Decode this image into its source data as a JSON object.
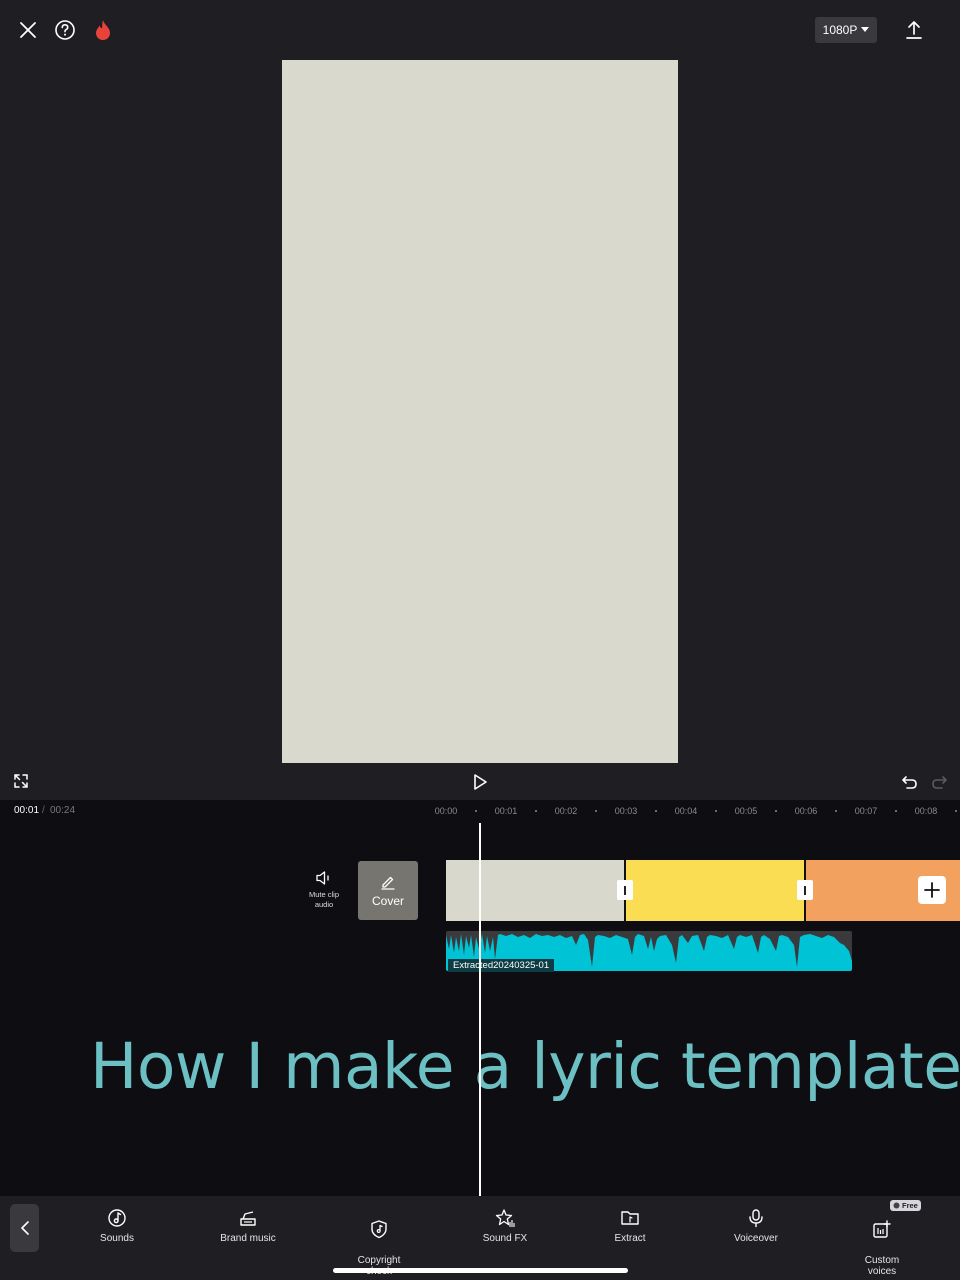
{
  "header": {
    "close_icon": "close-icon",
    "help_icon": "help-icon",
    "fire_icon": "fire-icon",
    "resolution": "1080P",
    "export_icon": "export-icon"
  },
  "player": {
    "fullscreen_icon": "fullscreen-icon",
    "play_icon": "play-icon",
    "undo_icon": "undo-icon",
    "redo_icon": "redo-icon",
    "current_time": "00:01",
    "separator": "/",
    "total_time": "00:24"
  },
  "timeline": {
    "ticks": [
      "00:00",
      "00:01",
      "00:02",
      "00:03",
      "00:04",
      "00:05",
      "00:06",
      "00:07",
      "00:08"
    ],
    "mute_label": "Mute clip audio",
    "cover_label": "Cover",
    "clips": [
      {
        "color": "#d8d8cc"
      },
      {
        "color": "#fbdd54"
      },
      {
        "color": "#f3a15f"
      }
    ],
    "audio_label": "Extracted20240325-01",
    "audio_color": "#00c3d6"
  },
  "overlay": {
    "text": "How I make a lyric template",
    "color": "#6cbfc2"
  },
  "toolbar": {
    "items": [
      {
        "label": "Sounds",
        "icon": "music-note-icon"
      },
      {
        "label": "Brand music",
        "icon": "brand-music-icon"
      },
      {
        "label": "Copyright\ncheck",
        "icon": "shield-icon"
      },
      {
        "label": "Sound FX",
        "icon": "star-sound-icon"
      },
      {
        "label": "Extract",
        "icon": "folder-icon"
      },
      {
        "label": "Voiceover",
        "icon": "microphone-icon"
      },
      {
        "label": "Custom\nvoices",
        "icon": "custom-voices-icon"
      }
    ],
    "free_badge": "Free"
  }
}
